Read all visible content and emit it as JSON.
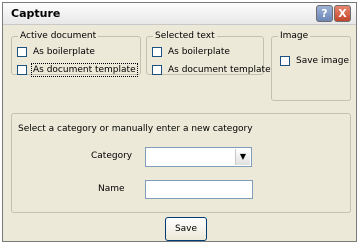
{
  "window": {
    "title": "Capture",
    "help_label": "?",
    "close_label": "X"
  },
  "groups": {
    "active_document": {
      "legend": "Active document",
      "options": [
        "As boilerplate",
        "As document template"
      ]
    },
    "selected_text": {
      "legend": "Selected text",
      "options": [
        "As boilerplate",
        "As document template"
      ]
    },
    "image": {
      "legend": "Image",
      "options": [
        "Save image"
      ]
    }
  },
  "category_section": {
    "prompt": "Select a category or manually enter a new category",
    "category_label": "Category",
    "category_value": "",
    "name_label": "Name",
    "name_value": ""
  },
  "save_label": "Save",
  "dropdown_icon": "chevron-down-icon",
  "colors": {
    "title_bar": "#e8e8e8",
    "dialog": "#ece9d8",
    "close": "#c2462a"
  }
}
